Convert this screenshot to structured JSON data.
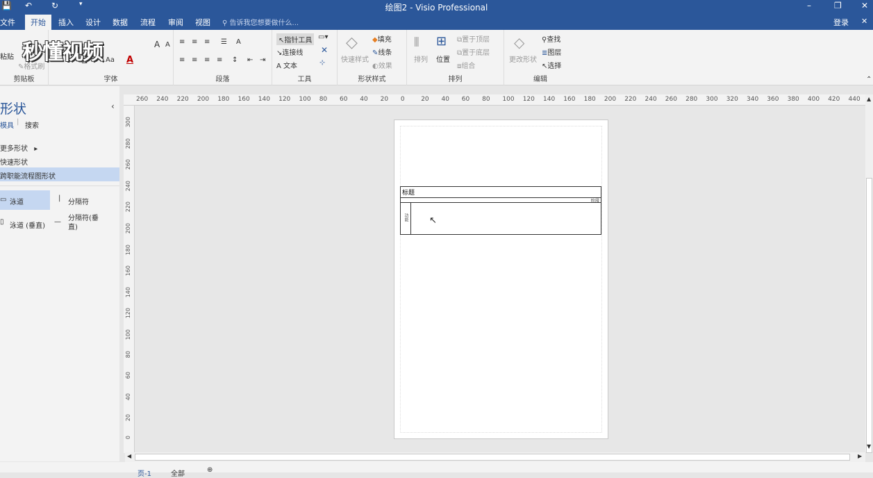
{
  "title_bar": {
    "title": "绘图2 - Visio Professional",
    "min": "–",
    "restore": "❐",
    "close": "✕"
  },
  "watermark": "秒懂视频",
  "menu": {
    "items": [
      "文件",
      "开始",
      "插入",
      "设计",
      "数据",
      "流程",
      "审阅",
      "视图"
    ],
    "tell_me": "告诉我您想要做什么...",
    "login": "登录"
  },
  "ribbon": {
    "clipboard": {
      "paste": "粘贴",
      "format_painter": "格式刷",
      "label": "剪贴板"
    },
    "font": {
      "label": "字体",
      "size_dropdown": "Aa"
    },
    "paragraph": {
      "label": "段落"
    },
    "tools": {
      "pointer": "指针工具",
      "connector": "连接线",
      "text": "文本",
      "label": "工具"
    },
    "shape_styles": {
      "quick_styles": "快速样式",
      "fill": "填充",
      "line": "线条",
      "effects": "效果",
      "label": "形状样式"
    },
    "arrange": {
      "align": "排列",
      "position": "位置",
      "bring_front": "置于顶层",
      "send_back": "置于底层",
      "group": "组合",
      "label": "排列"
    },
    "editing": {
      "change_shape": "更改形状",
      "find": "查找",
      "layers": "图层",
      "select": "选择",
      "label": "编辑"
    }
  },
  "shapes_panel": {
    "title": "形状",
    "tab_stencils": "模具",
    "tab_search": "搜索",
    "more_shapes": "更多形状",
    "quick_shapes": "快速形状",
    "cff_shapes": "跨职能流程图形状",
    "items": [
      {
        "label": "泳道"
      },
      {
        "label": "分隔符"
      },
      {
        "label": "泳道 (垂直)"
      },
      {
        "label": "分隔符(垂直)"
      }
    ]
  },
  "ruler_top": [
    "260",
    "240",
    "220",
    "200",
    "180",
    "160",
    "140",
    "120",
    "100",
    "80",
    "60",
    "40",
    "20",
    "0",
    "20",
    "40",
    "60",
    "80",
    "100",
    "120",
    "140",
    "160",
    "180",
    "200",
    "220",
    "240",
    "260",
    "280",
    "300",
    "320",
    "340",
    "360",
    "380",
    "400",
    "420",
    "440"
  ],
  "ruler_left": [
    "300",
    "280",
    "260",
    "240",
    "220",
    "200",
    "180",
    "160",
    "140",
    "120",
    "100",
    "80",
    "60",
    "40",
    "20",
    "0"
  ],
  "diagram": {
    "title": "标题",
    "phase_label": "阶段",
    "lane_label": "功能"
  },
  "status": {
    "page_tab": "页-1",
    "all": "全部"
  }
}
